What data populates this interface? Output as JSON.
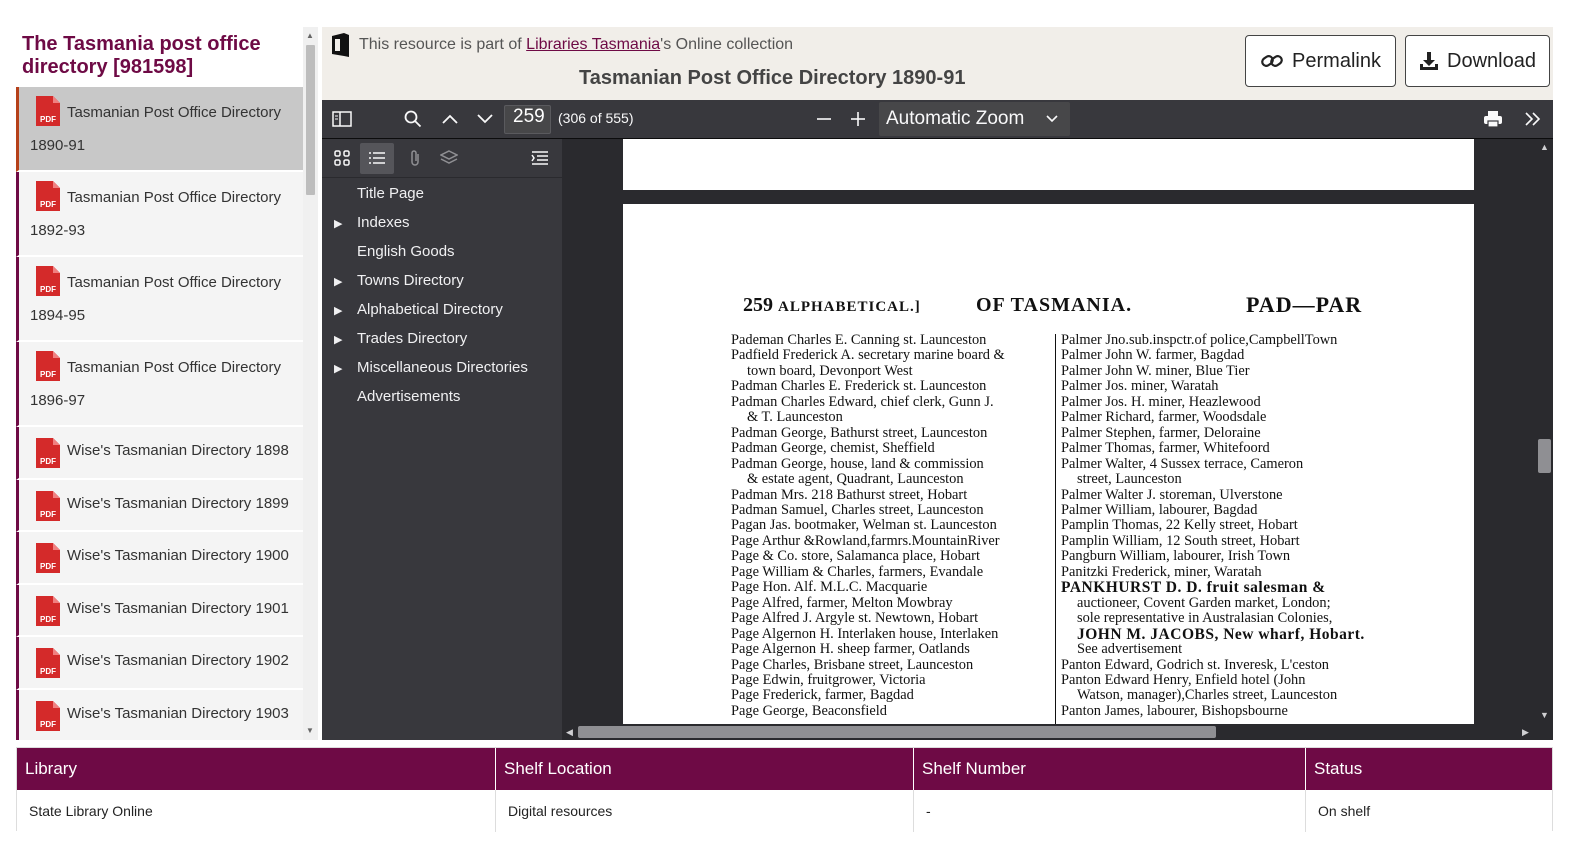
{
  "sidebar": {
    "title": "The Tasmania post office directory [981598]",
    "items": [
      {
        "title": "Tasmanian Post Office Directory",
        "year": "1890-91"
      },
      {
        "title": "Tasmanian Post Office Directory",
        "year": "1892-93"
      },
      {
        "title": "Tasmanian Post Office Directory",
        "year": "1894-95"
      },
      {
        "title": "Tasmanian Post Office Directory",
        "year": "1896-97"
      },
      {
        "title": "Wise's Tasmanian Directory 1898"
      },
      {
        "title": "Wise's Tasmanian Directory 1899"
      },
      {
        "title": "Wise's Tasmanian Directory 1900"
      },
      {
        "title": "Wise's Tasmanian Directory 1901"
      },
      {
        "title": "Wise's Tasmanian Directory 1902"
      },
      {
        "title": "Wise's Tasmanian Directory 1903"
      }
    ]
  },
  "header": {
    "resource_prefix": "This resource is part of ",
    "resource_link": "Libraries Tasmania",
    "resource_suffix": "'s Online collection",
    "title": "Tasmanian Post Office Directory 1890-91",
    "permalink_label": "Permalink",
    "download_label": "Download"
  },
  "toolbar": {
    "page_number": "259",
    "page_of": "(306 of 555)",
    "zoom": "Automatic Zoom"
  },
  "outline": [
    {
      "label": "Title Page",
      "expandable": false
    },
    {
      "label": "Indexes",
      "expandable": true
    },
    {
      "label": "English Goods",
      "expandable": false
    },
    {
      "label": "Towns Directory",
      "expandable": true
    },
    {
      "label": "Alphabetical Directory",
      "expandable": true
    },
    {
      "label": "Trades Directory",
      "expandable": true
    },
    {
      "label": "Miscellaneous Directories",
      "expandable": true
    },
    {
      "label": "Advertisements",
      "expandable": false
    }
  ],
  "page": {
    "number": "259",
    "section": "ALPHABETICAL.]",
    "middle": "OF TASMANIA.",
    "right": "PAD—PAR",
    "left_lines": [
      "Pademan Charles E. Canning st. Launceston",
      "Padfield Frederick A. secretary marine board &",
      "  town board, Devonport West",
      "Padman Charles E. Frederick st. Launceston",
      "Padman Charles Edward, chief clerk, Gunn J.",
      "  & T. Launceston",
      "Padman George, Bathurst street, Launceston",
      "Padman George, chemist, Sheffield",
      "Padman George, house, land & commission",
      "  & estate agent, Quadrant, Launceston",
      "Padman Mrs. 218 Bathurst street, Hobart",
      "Padman Samuel, Charles street, Launceston",
      "Pagan Jas. bootmaker, Welman st. Launceston",
      "Page Arthur &Rowland,farmrs.MountainRiver",
      "Page & Co. store, Salamanca place, Hobart",
      "Page William & Charles, farmers, Evandale",
      "Page Hon. Alf. M.L.C. Macquarie",
      "Page Alfred, farmer, Melton Mowbray",
      "Page Alfred J. Argyle st. Newtown, Hobart",
      "Page Algernon H. Interlaken house, Interlaken",
      "Page Algernon H. sheep farmer, Oatlands",
      "Page Charles, Brisbane street, Launceston",
      "Page Edwin, fruitgrower, Victoria",
      "Page Frederick, farmer, Bagdad",
      "Page George, Beaconsfield"
    ],
    "right_lines": [
      "Palmer Jno.sub.inspctr.of police,CampbellTown",
      "Palmer John W. farmer, Bagdad",
      "Palmer John W. miner, Blue Tier",
      "Palmer Jos. miner, Waratah",
      "Palmer Jos. H. miner, Heazlewood",
      "Palmer Richard, farmer, Woodsdale",
      "Palmer Stephen, farmer, Deloraine",
      "Palmer Thomas, farmer, Whitefoord",
      "Palmer Walter, 4 Sussex terrace, Cameron",
      "  street, Launceston",
      "Palmer Walter J. storeman, Ulverstone",
      "Palmer William, labourer, Bagdad",
      "Pamplin Thomas, 22 Kelly street, Hobart",
      "Pamplin William, 12 South street, Hobart",
      "Pangburn William, labourer, Irish Town",
      "Panitzki Frederick, miner, Waratah",
      "PANKHURST D. D. fruit salesman &",
      "  auctioneer, Covent Garden market, London;",
      "  sole representative in Australasian Colonies,",
      "  JOHN M. JACOBS, New wharf, Hobart.",
      "  See advertisement",
      "Panton Edward, Godrich st. Inveresk, L'ceston",
      "Panton Edward Henry, Enfield hotel (John",
      "  Watson, manager),Charles street, Launceston",
      "Panton James, labourer, Bishopsbourne"
    ]
  },
  "table": {
    "headers": [
      "Library",
      "Shelf Location",
      "Shelf Number",
      "Status"
    ],
    "row": [
      "State Library Online",
      "Digital resources",
      "-",
      "On shelf"
    ]
  },
  "colors": {
    "brand": "#6e0a45",
    "viewer_bg": "#2a2a2e",
    "toolbar_bg": "#38383d"
  }
}
